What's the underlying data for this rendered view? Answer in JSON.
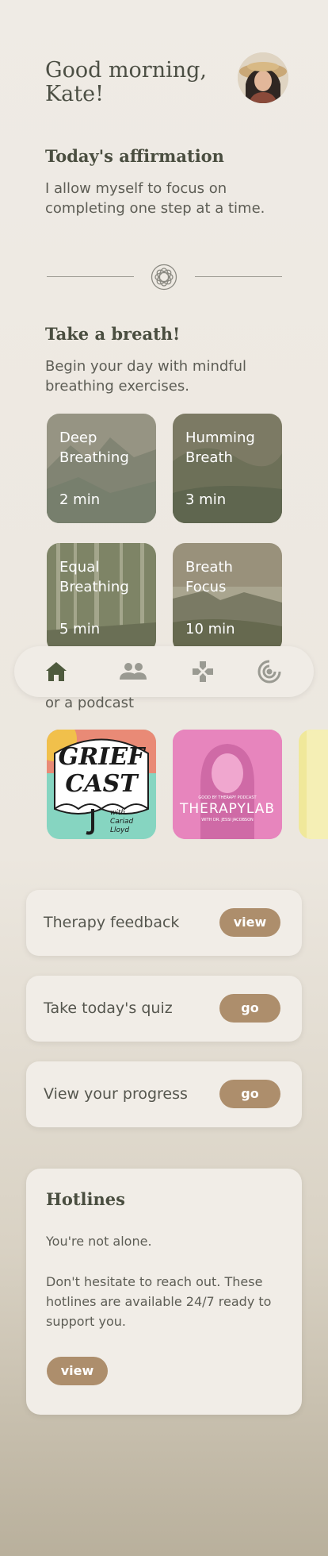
{
  "header": {
    "greeting": "Good morning, Kate!"
  },
  "affirmation": {
    "heading": "Today's affirmation",
    "text": "I allow myself to focus on completing one step at a time."
  },
  "breath": {
    "heading": "Take a breath!",
    "subtitle": "Begin your day with mindful breathing exercises.",
    "cards": [
      {
        "title": "Deep Breathing",
        "duration": "2 min"
      },
      {
        "title": "Humming Breath",
        "duration": "3 min"
      },
      {
        "title": "Equal Breathing",
        "duration": "5 min"
      },
      {
        "title": "Breath Focus",
        "duration": "10 min"
      }
    ]
  },
  "podcasts": {
    "label": "or a podcast",
    "items": [
      {
        "title": "GRIEF CAST",
        "subtitle": "with Cariad Lloyd"
      },
      {
        "title": "THERAPYLAB",
        "kicker": "GOOD BY THERAPY PODCAST",
        "subtitle": "WITH DR. JESSI JACOBSON"
      }
    ]
  },
  "actions": [
    {
      "label": "Therapy feedback",
      "button": "view"
    },
    {
      "label": "Take today's quiz",
      "button": "go"
    },
    {
      "label": "View your progress",
      "button": "go"
    }
  ],
  "hotlines": {
    "heading": "Hotlines",
    "line1": "You're not alone.",
    "line2": "Don't hesitate to reach out. These hotlines are available 24/7 ready to support you.",
    "button": "view"
  },
  "nav": {
    "items": [
      "home-icon",
      "community-icon",
      "games-icon",
      "progress-icon"
    ],
    "active_color": "#4e5a3d",
    "inactive_color": "#9a9a92"
  },
  "colors": {
    "accent": "#ad8e6c",
    "heading": "#4a4e40"
  }
}
